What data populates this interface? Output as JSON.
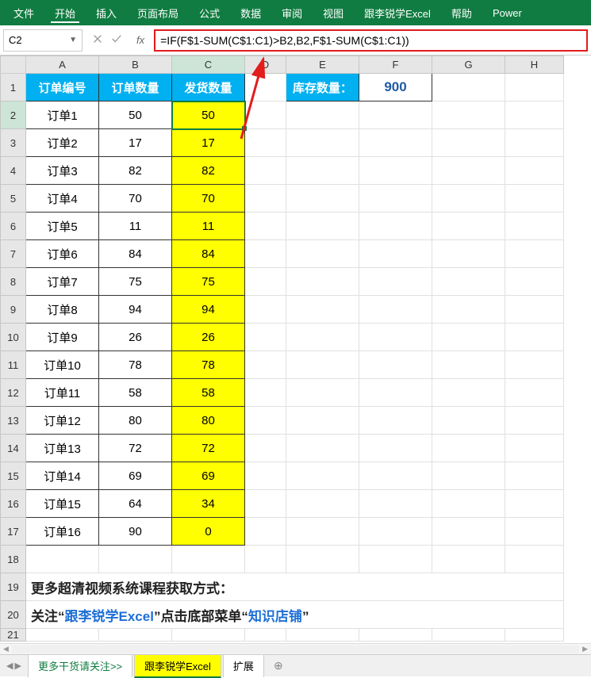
{
  "ribbon": {
    "tabs": [
      "文件",
      "开始",
      "插入",
      "页面布局",
      "公式",
      "数据",
      "审阅",
      "视图",
      "跟李锐学Excel",
      "帮助",
      "Power"
    ],
    "activeIndex": 1
  },
  "nameBox": "C2",
  "formula": "=IF(F$1-SUM(C$1:C1)>B2,B2,F$1-SUM(C$1:C1))",
  "columns": [
    "A",
    "B",
    "C",
    "D",
    "E",
    "F",
    "G",
    "H"
  ],
  "headerRow": {
    "A": "订单编号",
    "B": "订单数量",
    "C": "发货数量",
    "E": "库存数量：",
    "F": "900"
  },
  "dataRows": [
    {
      "r": 2,
      "A": "订单1",
      "B": "50",
      "C": "50"
    },
    {
      "r": 3,
      "A": "订单2",
      "B": "17",
      "C": "17"
    },
    {
      "r": 4,
      "A": "订单3",
      "B": "82",
      "C": "82"
    },
    {
      "r": 5,
      "A": "订单4",
      "B": "70",
      "C": "70"
    },
    {
      "r": 6,
      "A": "订单5",
      "B": "11",
      "C": "11"
    },
    {
      "r": 7,
      "A": "订单6",
      "B": "84",
      "C": "84"
    },
    {
      "r": 8,
      "A": "订单7",
      "B": "75",
      "C": "75"
    },
    {
      "r": 9,
      "A": "订单8",
      "B": "94",
      "C": "94"
    },
    {
      "r": 10,
      "A": "订单9",
      "B": "26",
      "C": "26"
    },
    {
      "r": 11,
      "A": "订单10",
      "B": "78",
      "C": "78"
    },
    {
      "r": 12,
      "A": "订单11",
      "B": "58",
      "C": "58"
    },
    {
      "r": 13,
      "A": "订单12",
      "B": "80",
      "C": "80"
    },
    {
      "r": 14,
      "A": "订单13",
      "B": "72",
      "C": "72"
    },
    {
      "r": 15,
      "A": "订单14",
      "B": "69",
      "C": "69"
    },
    {
      "r": 16,
      "A": "订单15",
      "B": "64",
      "C": "34"
    },
    {
      "r": 17,
      "A": "订单16",
      "B": "90",
      "C": "0"
    }
  ],
  "note1": "更多超清视频系统课程获取方式：",
  "note2": {
    "pre": "关注“",
    "link1": "跟李锐学Excel",
    "mid": "”点击底部菜单“",
    "link2": "知识店铺",
    "post": "”"
  },
  "sheetTabs": [
    "更多干货请关注>>",
    "跟李锐学Excel",
    "扩展"
  ],
  "activeSheetTab": 1,
  "selectedCell": "C2"
}
